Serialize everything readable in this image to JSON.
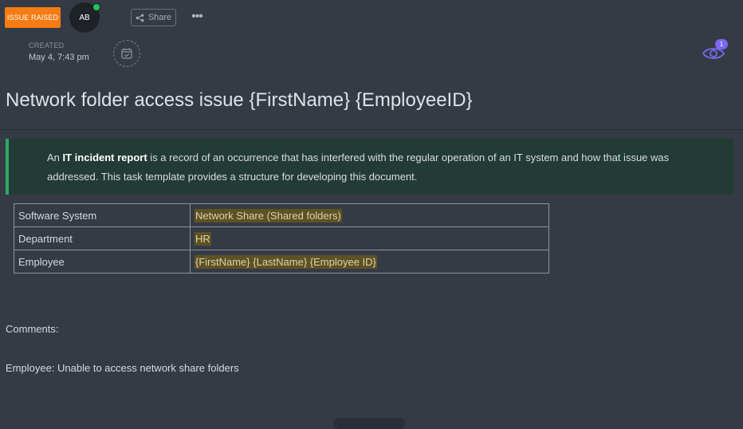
{
  "header": {
    "status_label": "ISSUE RAISED",
    "avatar_initials": "AB",
    "share_label": "Share",
    "more_label": "•••"
  },
  "meta": {
    "created_label": "CREATED",
    "created_value": "May 4, 7:43 pm"
  },
  "watchers": {
    "count": "1"
  },
  "task": {
    "title": "Network folder access issue {FirstName} {EmployeeID}"
  },
  "callout": {
    "prefix": "An ",
    "bold": "IT incident report",
    "rest": " is a record of an occurrence that has interfered with the regular operation of an IT system and how that issue was addressed. This task template provides a structure for developing this document."
  },
  "info_table": [
    {
      "key": "Software System",
      "value": "Network Share  (Shared folders)"
    },
    {
      "key": "Department",
      "value": "HR"
    },
    {
      "key": "Employee",
      "value": "{FirstName} {LastName} {Employee ID}"
    }
  ],
  "comments": {
    "label": "Comments:",
    "line": "Employee: Unable to access network share folders"
  },
  "colors": {
    "status_orange": "#f57c14",
    "callout_border": "#2fa864",
    "highlight": "#5e5124",
    "watch_accent": "#7b68ee",
    "presence_online": "#22c55e"
  },
  "icons": [
    "share-icon",
    "more-icon",
    "calendar-check-icon",
    "eye-icon",
    "presence-dot"
  ]
}
